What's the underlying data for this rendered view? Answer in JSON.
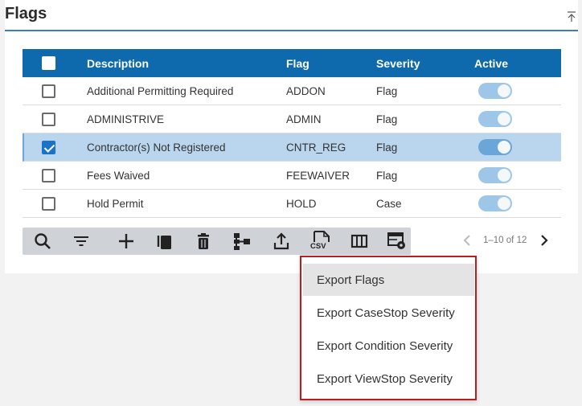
{
  "panel": {
    "title": "Flags"
  },
  "grid": {
    "columns": [
      "Description",
      "Flag",
      "Severity",
      "Active"
    ],
    "rows": [
      {
        "description": "Additional Permitting Required",
        "flag": "ADDON",
        "severity": "Flag",
        "active": true,
        "checked": false
      },
      {
        "description": "ADMINISTRIVE",
        "flag": "ADMIN",
        "severity": "Flag",
        "active": true,
        "checked": false
      },
      {
        "description": "Contractor(s) Not Registered",
        "flag": "CNTR_REG",
        "severity": "Flag",
        "active": true,
        "checked": true
      },
      {
        "description": "Fees Waived",
        "flag": "FEEWAIVER",
        "severity": "Flag",
        "active": true,
        "checked": false
      },
      {
        "description": "Hold Permit",
        "flag": "HOLD",
        "severity": "Case",
        "active": true,
        "checked": false
      }
    ]
  },
  "toolbar": {
    "buttons": [
      "search-icon",
      "filter-icon",
      "add-icon",
      "copy-icon",
      "delete-icon",
      "hierarchy-icon",
      "export-icon",
      "csv-icon",
      "columns-icon",
      "settings-table-icon"
    ],
    "csv_label": "CSV"
  },
  "pager": {
    "label": "1–10 of 12"
  },
  "export_menu": {
    "items": [
      "Export Flags",
      "Export CaseStop Severity",
      "Export Condition Severity",
      "Export ViewStop Severity"
    ]
  },
  "colors": {
    "header": "#0e69ad",
    "selected_row": "#b9d6ee",
    "toggle": "#9ec6e8",
    "menu_border": "#b81d24"
  }
}
